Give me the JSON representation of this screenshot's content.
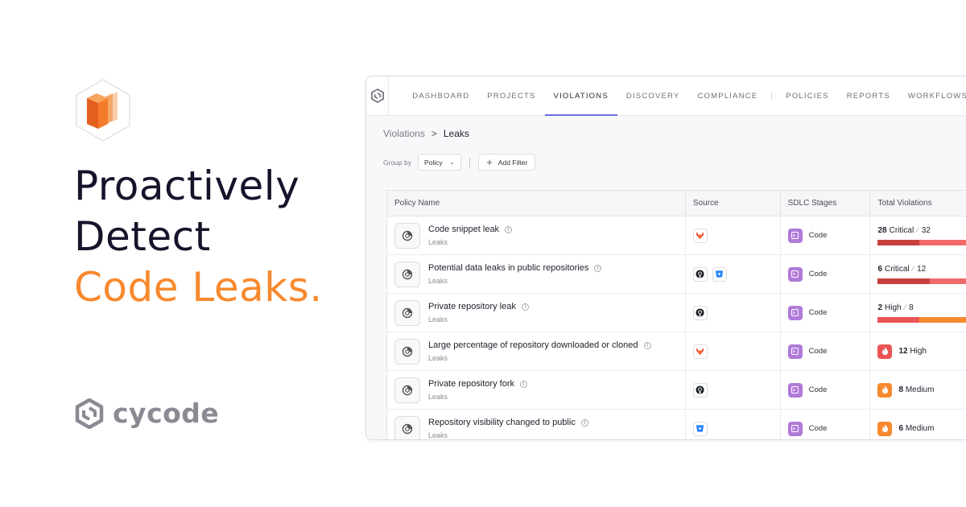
{
  "headline": {
    "line1": "Proactively",
    "line2": "Detect",
    "line3": "Code Leaks."
  },
  "brand": {
    "name": "cycode"
  },
  "colors": {
    "accent_orange": "#f7892e",
    "nav_active": "#6b6ee0",
    "stage_purple": "#b07ad8",
    "critical_dark": "#c9413f",
    "critical_light": "#f06a6a",
    "high_orange": "#f7892e",
    "high_red": "#ea5455",
    "medium_orange": "#f7892e"
  },
  "nav": {
    "items": [
      {
        "label": "DASHBOARD",
        "active": false
      },
      {
        "label": "PROJECTS",
        "active": false
      },
      {
        "label": "VIOLATIONS",
        "active": true
      },
      {
        "label": "DISCOVERY",
        "active": false
      },
      {
        "label": "COMPLIANCE",
        "active": false
      },
      {
        "label": "POLICIES",
        "active": false
      },
      {
        "label": "REPORTS",
        "active": false
      },
      {
        "label": "WORKFLOWS",
        "active": false
      }
    ]
  },
  "breadcrumb": {
    "parent": "Violations",
    "separator": ">",
    "current": "Leaks"
  },
  "filters": {
    "group_by_label": "Group by",
    "group_by_value": "Policy",
    "add_filter_label": "Add Filter"
  },
  "table": {
    "headers": [
      "Policy Name",
      "Source",
      "SDLC Stages",
      "Total Violations"
    ],
    "rows": [
      {
        "name": "Code snippet leak",
        "category": "Leaks",
        "sources": [
          "gitlab-icon"
        ],
        "stage": "Code",
        "violations": {
          "count": "28",
          "severity": "Critical",
          "total": "32",
          "bar": [
            0.4,
            0.6
          ]
        }
      },
      {
        "name": "Potential data leaks in public repositories",
        "category": "Leaks",
        "sources": [
          "github-icon",
          "bitbucket-icon"
        ],
        "stage": "Code",
        "violations": {
          "count": "6",
          "severity": "Critical",
          "total": "12",
          "bar": [
            0.5,
            0.5
          ]
        }
      },
      {
        "name": "Private repository leak",
        "category": "Leaks",
        "sources": [
          "github-icon"
        ],
        "stage": "Code",
        "violations": {
          "count": "2",
          "severity": "High",
          "total": "8",
          "bar": [
            0.4,
            0.6
          ]
        }
      },
      {
        "name": "Large percentage of repository downloaded or cloned",
        "category": "Leaks",
        "sources": [
          "gitlab-icon"
        ],
        "stage": "Code",
        "violations": {
          "count": "12",
          "severity": "High"
        }
      },
      {
        "name": "Private repository fork",
        "category": "Leaks",
        "sources": [
          "github-icon"
        ],
        "stage": "Code",
        "violations": {
          "count": "8",
          "severity": "Medium"
        }
      },
      {
        "name": "Repository visibility changed to public",
        "category": "Leaks",
        "sources": [
          "bitbucket-icon"
        ],
        "stage": "Code",
        "violations": {
          "count": "6",
          "severity": "Medium"
        }
      }
    ]
  }
}
